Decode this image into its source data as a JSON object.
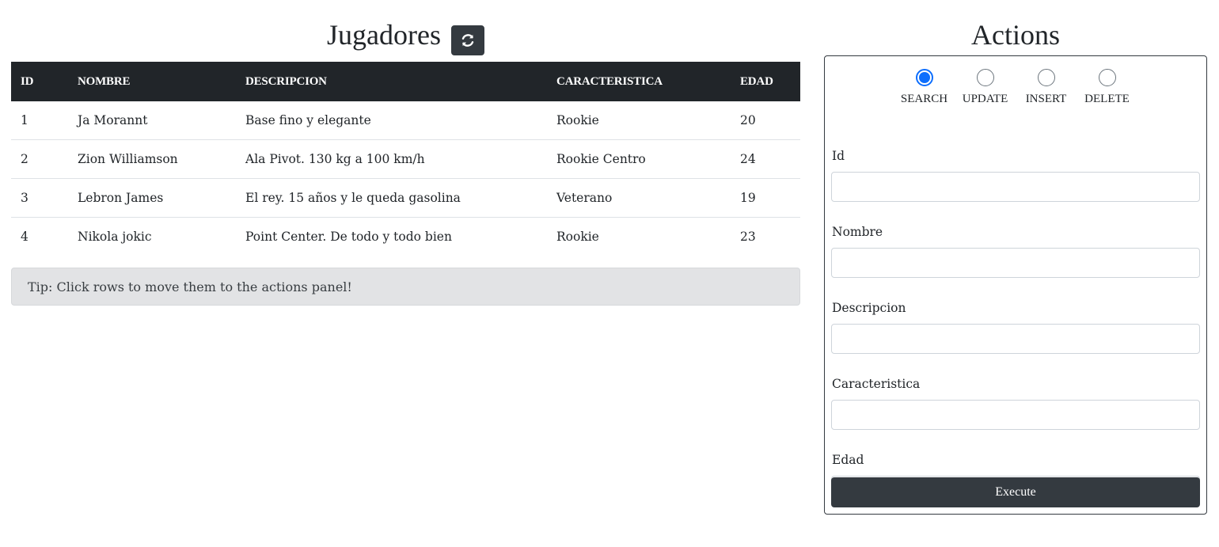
{
  "players_panel": {
    "title": "Jugadores",
    "refresh_icon": "refresh-icon",
    "columns": [
      "ID",
      "NOMBRE",
      "DESCRIPCION",
      "CARACTERISTICA",
      "EDAD"
    ],
    "rows": [
      {
        "id": "1",
        "nombre": "Ja Morannt",
        "descripcion": "Base fino y elegante",
        "caracteristica": "Rookie",
        "edad": "20"
      },
      {
        "id": "2",
        "nombre": "Zion Williamson",
        "descripcion": "Ala Pivot. 130 kg a 100 km/h",
        "caracteristica": "Rookie Centro",
        "edad": "24"
      },
      {
        "id": "3",
        "nombre": "Lebron James",
        "descripcion": "El rey. 15 años y le queda gasolina",
        "caracteristica": "Veterano",
        "edad": "19"
      },
      {
        "id": "4",
        "nombre": "Nikola jokic",
        "descripcion": "Point Center. De todo y todo bien",
        "caracteristica": "Rookie",
        "edad": "23"
      }
    ],
    "tip": "Tip: Click rows to move them to the actions panel!"
  },
  "actions_panel": {
    "title": "Actions",
    "modes": [
      {
        "label": "SEARCH",
        "checked": true
      },
      {
        "label": "UPDATE",
        "checked": false
      },
      {
        "label": "INSERT",
        "checked": false
      },
      {
        "label": "DELETE",
        "checked": false
      }
    ],
    "fields": [
      {
        "label": "Id",
        "value": ""
      },
      {
        "label": "Nombre",
        "value": ""
      },
      {
        "label": "Descripcion",
        "value": ""
      },
      {
        "label": "Caracteristica",
        "value": ""
      },
      {
        "label": "Edad",
        "value": ""
      }
    ],
    "execute_label": "Execute"
  },
  "colors": {
    "dark": "#212529",
    "button_dark": "#343a40",
    "radio_accent": "#0d6efd",
    "tip_bg": "#e2e3e5"
  }
}
